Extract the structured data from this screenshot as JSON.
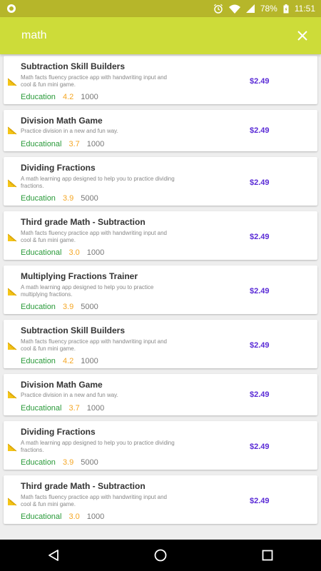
{
  "status_bar": {
    "battery": "78%",
    "time": "11:51"
  },
  "search": {
    "query": "math"
  },
  "results": [
    {
      "title": "Subtraction Skill Builders",
      "description": "Math facts fluency practice app with handwriting input and cool & fun mini game.",
      "category": "Education",
      "rating": "4.2",
      "downloads": "1000",
      "price": "$2.49"
    },
    {
      "title": "Division Math Game",
      "description": "Practice division in a new and fun way.",
      "category": "Educational",
      "rating": "3.7",
      "downloads": "1000",
      "price": "$2.49"
    },
    {
      "title": "Dividing Fractions",
      "description": "A math learning app designed to help you to practice dividing fractions.",
      "category": "Education",
      "rating": "3.9",
      "downloads": "5000",
      "price": "$2.49"
    },
    {
      "title": "Third grade Math - Subtraction",
      "description": "Math facts fluency practice app with handwriting input and cool & fun mini game.",
      "category": "Educational",
      "rating": "3.0",
      "downloads": "1000",
      "price": "$2.49"
    },
    {
      "title": "Multiplying Fractions Trainer",
      "description": "A math learning app designed to help you to practice multiplying fractions.",
      "category": "Education",
      "rating": "3.9",
      "downloads": "5000",
      "price": "$2.49"
    },
    {
      "title": "Subtraction Skill Builders",
      "description": "Math facts fluency practice app with handwriting input and cool & fun mini game.",
      "category": "Education",
      "rating": "4.2",
      "downloads": "1000",
      "price": "$2.49"
    },
    {
      "title": "Division Math Game",
      "description": "Practice division in a new and fun way.",
      "category": "Educational",
      "rating": "3.7",
      "downloads": "1000",
      "price": "$2.49"
    },
    {
      "title": "Dividing Fractions",
      "description": "A math learning app designed to help you to practice dividing fractions.",
      "category": "Education",
      "rating": "3.9",
      "downloads": "5000",
      "price": "$2.49"
    },
    {
      "title": "Third grade Math - Subtraction",
      "description": "Math facts fluency practice app with handwriting input and cool & fun mini game.",
      "category": "Educational",
      "rating": "3.0",
      "downloads": "1000",
      "price": "$2.49"
    }
  ],
  "colors": {
    "header": "#cddc39",
    "status_bar": "#b6b62a",
    "category": "#2a9a3a",
    "rating": "#f5a623",
    "price": "#5a2bd6"
  },
  "icons": {
    "status": [
      "notification-dot-icon",
      "alarm-icon",
      "wifi-icon",
      "signal-icon",
      "battery-icon"
    ],
    "header": [
      "close-icon"
    ],
    "card": "ruler-icon",
    "nav": [
      "back-icon",
      "home-icon",
      "recents-icon"
    ]
  }
}
